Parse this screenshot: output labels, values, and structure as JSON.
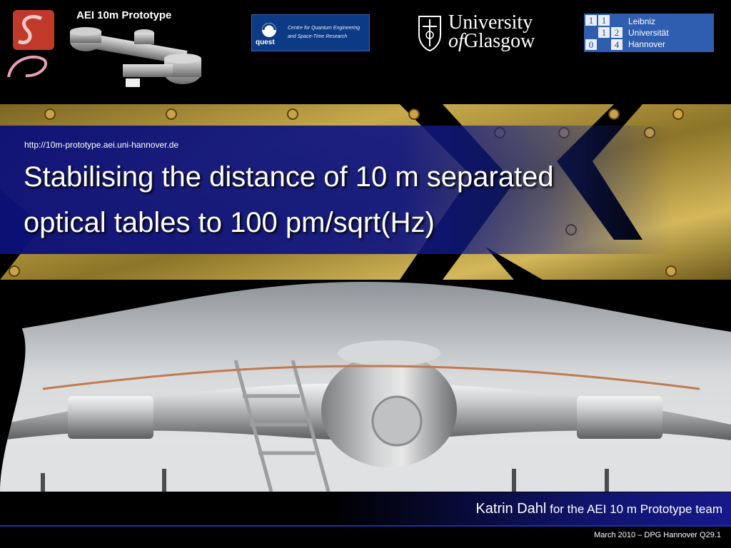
{
  "header": {
    "prototype_title": "AEI 10m Prototype",
    "quest": {
      "name": "quest",
      "line1": "Centre for Quantum Engineering",
      "line2": "and Space-Time Research"
    },
    "glasgow": {
      "word1": "University",
      "word2_of": "of",
      "word2_city": "Glasgow"
    },
    "leibniz": {
      "line1": "Leibniz",
      "line2": "Universität",
      "line3": "Hannover",
      "grid": [
        "1",
        "1",
        "1",
        "2",
        "0",
        "4"
      ]
    }
  },
  "title_block": {
    "url": "http://10m-prototype.aei.uni-hannover.de",
    "line1": "Stabilising the distance of  10 m separated",
    "line2": "optical tables to 100 pm/sqrt(Hz)"
  },
  "footer": {
    "author": "Katrin Dahl",
    "author_suffix": " for the AEI 10 m Prototype team",
    "date_event": "March 2010 – DPG Hannover Q29.1"
  },
  "colors": {
    "title_panel": "#0c1078",
    "leibniz_blue": "#2f5db0",
    "quest_blue": "#0d3a85",
    "aei_red": "#c0392b",
    "gold": "#b89a3a"
  },
  "icons": {
    "aei": "aei-logo-icon",
    "quest": "quest-logo-icon",
    "glasgow": "glasgow-crest-icon"
  }
}
